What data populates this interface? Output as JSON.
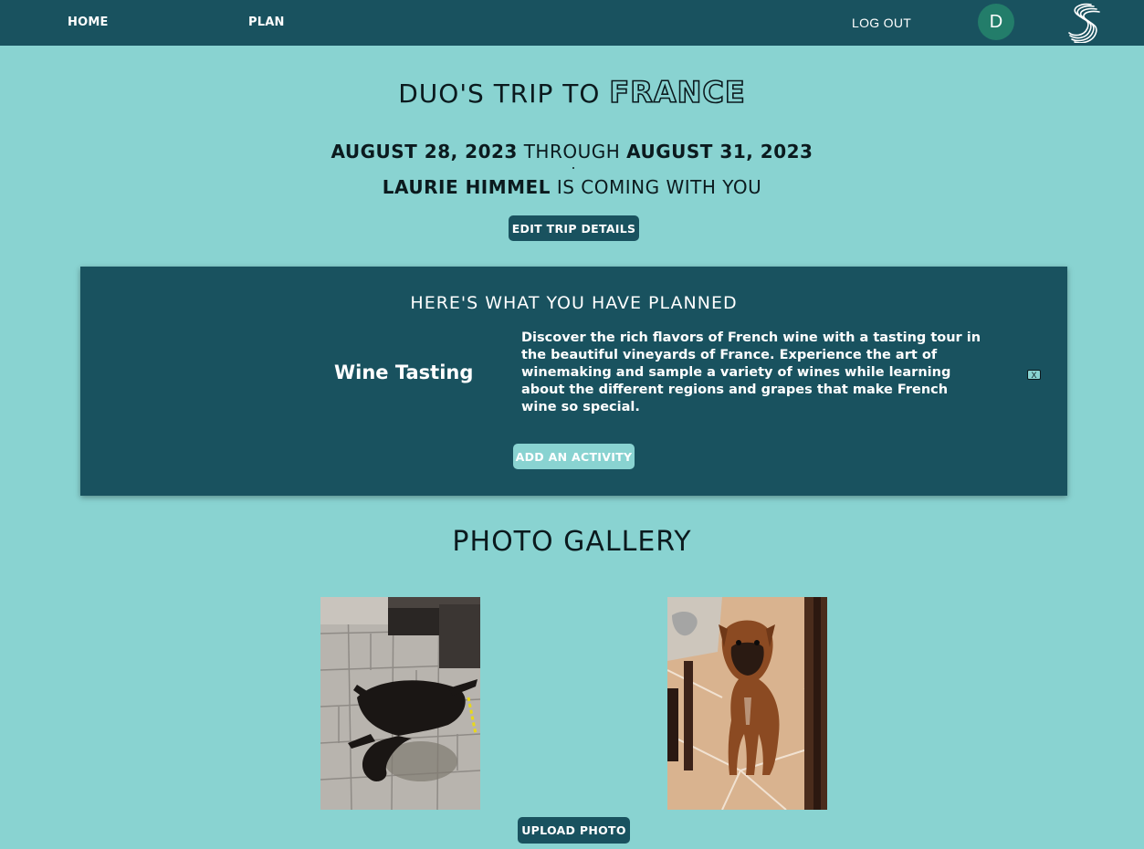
{
  "nav": {
    "home": "HOME",
    "plan": "PLAN",
    "logout": "LOG OUT",
    "avatar_initial": "D",
    "logo_icon": "wave-logo-icon"
  },
  "trip": {
    "title_prefix": "DUO'S TRIP TO",
    "destination": "FRANCE",
    "start_date": "AUGUST 28, 2023",
    "through": "THROUGH",
    "end_date": "AUGUST 31, 2023",
    "companion": "LAURIE HIMMEL",
    "companion_suffix": "IS COMING WITH YOU",
    "edit_button": "EDIT TRIP DETAILS"
  },
  "planned": {
    "heading": "HERE'S WHAT YOU HAVE PLANNED",
    "activities": [
      {
        "name": "Wine Tasting",
        "description": "Discover the rich flavors of French wine with a tasting tour in the beautiful vineyards of France. Experience the art of winemaking and sample a variety of wines while learning about the different regions and grapes that make French wine so special.",
        "remove_label": "X"
      }
    ],
    "add_button": "ADD AN ACTIVITY"
  },
  "gallery": {
    "heading": "PHOTO GALLERY",
    "photos": [
      {
        "subject": "black dog lying on patio stones"
      },
      {
        "subject": "boxer dog standing on tile floor"
      }
    ],
    "upload_button": "UPLOAD PHOTO"
  },
  "colors": {
    "background": "#89d3d1",
    "nav": "#19525f",
    "avatar": "#237d6a",
    "text": "#0b1a1e"
  }
}
